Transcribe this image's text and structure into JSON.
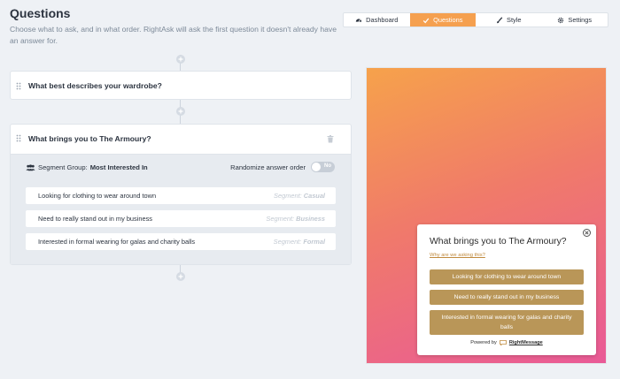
{
  "page": {
    "title": "Questions",
    "subtitle": "Choose what to ask, and in what order. RightAsk will ask the first question it doesn't already have an answer for."
  },
  "tabs": [
    {
      "label": "Dashboard",
      "icon": "dashboard-icon",
      "active": false
    },
    {
      "label": "Questions",
      "icon": "check-icon",
      "active": true
    },
    {
      "label": "Style",
      "icon": "brush-icon",
      "active": false
    },
    {
      "label": "Settings",
      "icon": "gear-icon",
      "active": false
    }
  ],
  "questions": [
    {
      "text": "What best describes your wardrobe?"
    },
    {
      "text": "What brings you to The Armoury?",
      "segment_group_label": "Segment Group:",
      "segment_group_value": "Most Interested In",
      "randomize_label": "Randomize answer order",
      "randomize_toggle": "No",
      "answers": [
        {
          "text": "Looking for clothing to wear around town",
          "segment_prefix": "Segment:",
          "segment": "Casual"
        },
        {
          "text": "Need to really stand out in my business",
          "segment_prefix": "Segment:",
          "segment": "Business"
        },
        {
          "text": "Interested in formal wearing for galas and charity balls",
          "segment_prefix": "Segment:",
          "segment": "Formal"
        }
      ]
    }
  ],
  "preview": {
    "question": "What brings you to The Armoury?",
    "why_link": "Why are we asking this?",
    "buttons": [
      "Looking for clothing to wear around town",
      "Need to really stand out in my business",
      "Interested in formal wearing for galas and charity balls"
    ],
    "powered_by": "Powered by",
    "brand": "RightMessage"
  },
  "colors": {
    "accent": "#f5a04f",
    "button": "#b99658",
    "gradient_start": "#f6a24b",
    "gradient_end": "#e95a97"
  }
}
